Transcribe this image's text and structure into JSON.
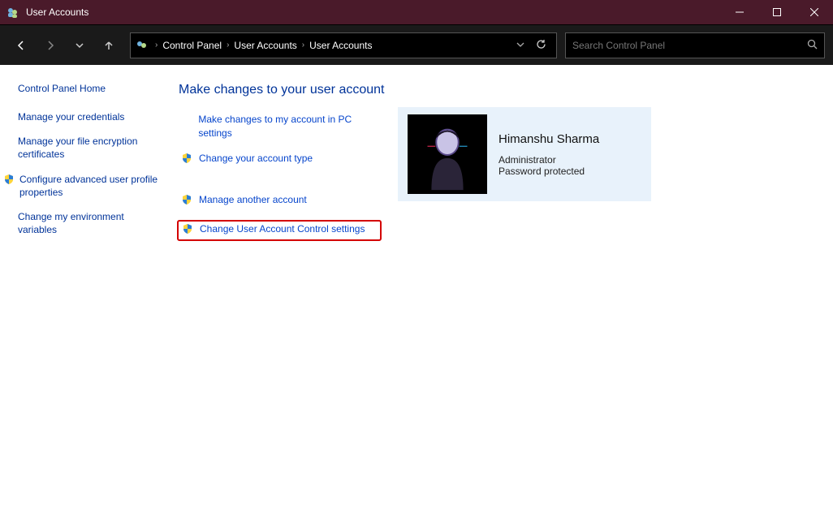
{
  "window": {
    "title": "User Accounts"
  },
  "nav": {
    "breadcrumbs": [
      "Control Panel",
      "User Accounts",
      "User Accounts"
    ],
    "search_placeholder": "Search Control Panel"
  },
  "sidebar": {
    "home": "Control Panel Home",
    "links": [
      {
        "label": "Manage your credentials",
        "shield": false
      },
      {
        "label": "Manage your file encryption certificates",
        "shield": false
      },
      {
        "label": "Configure advanced user profile properties",
        "shield": true
      },
      {
        "label": "Change my environment variables",
        "shield": false
      }
    ]
  },
  "main": {
    "heading": "Make changes to your user account",
    "tasks": [
      {
        "label": "Make changes to my account in PC settings",
        "shield": false,
        "gap_after": false,
        "highlight": false
      },
      {
        "label": "Change your account type",
        "shield": true,
        "gap_after": true,
        "highlight": false
      },
      {
        "label": "Manage another account",
        "shield": true,
        "gap_after": false,
        "highlight": false
      },
      {
        "label": "Change User Account Control settings",
        "shield": true,
        "gap_after": false,
        "highlight": true
      }
    ]
  },
  "user": {
    "name": "Himanshu Sharma",
    "role": "Administrator",
    "status": "Password protected"
  },
  "help": "?"
}
